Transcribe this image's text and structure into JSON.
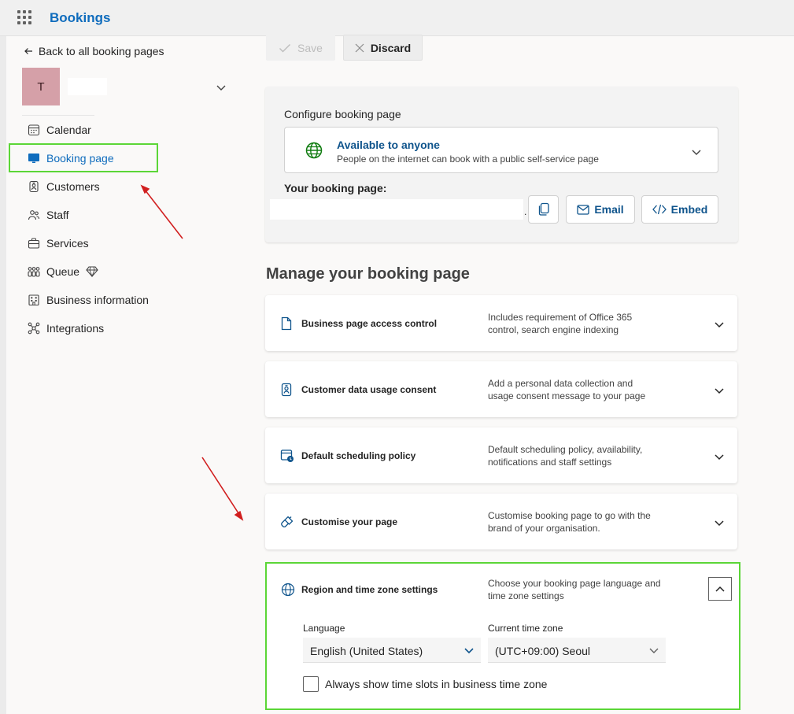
{
  "app": {
    "title": "Bookings"
  },
  "toolbar": {
    "save_label": "Save",
    "discard_label": "Discard"
  },
  "sidebar": {
    "back_label": "Back to all booking pages",
    "avatar_initial": "T",
    "items": [
      {
        "label": "Calendar",
        "icon": "calendar-icon"
      },
      {
        "label": "Booking page",
        "icon": "monitor-icon",
        "active": true
      },
      {
        "label": "Customers",
        "icon": "badge-icon"
      },
      {
        "label": "Staff",
        "icon": "people-icon"
      },
      {
        "label": "Services",
        "icon": "briefcase-icon"
      },
      {
        "label": "Queue",
        "icon": "queue-icon"
      },
      {
        "label": "Business information",
        "icon": "building-icon"
      },
      {
        "label": "Integrations",
        "icon": "integrations-icon"
      }
    ]
  },
  "configure": {
    "title": "Configure booking page",
    "availability_title": "Available to anyone",
    "availability_sub": "People on the internet can book with a public self-service page",
    "your_page_label": "Your booking page:",
    "url_suffix": ".",
    "email_label": "Email",
    "embed_label": "Embed"
  },
  "manage": {
    "title": "Manage your booking page",
    "sections": [
      {
        "title": "Business page access control",
        "desc": "Includes requirement of Office 365 control, search engine indexing"
      },
      {
        "title": "Customer data usage consent",
        "desc": "Add a personal data collection and usage consent message to your page"
      },
      {
        "title": "Default scheduling policy",
        "desc": "Default scheduling policy, availability, notifications and staff settings"
      },
      {
        "title": "Customise your page",
        "desc": "Customise booking page to go with the brand of your organisation."
      }
    ],
    "region": {
      "title": "Region and time zone settings",
      "desc": "Choose your booking page language and time zone settings",
      "language_label": "Language",
      "language_value": "English (United States)",
      "timezone_label": "Current time zone",
      "timezone_value": "(UTC+09:00) Seoul",
      "checkbox_label": "Always show time slots in business time zone",
      "checkbox_checked": false
    }
  },
  "colors": {
    "accent": "#0f6cbd",
    "highlight": "#5bd637",
    "arrow": "#d11f1f"
  }
}
